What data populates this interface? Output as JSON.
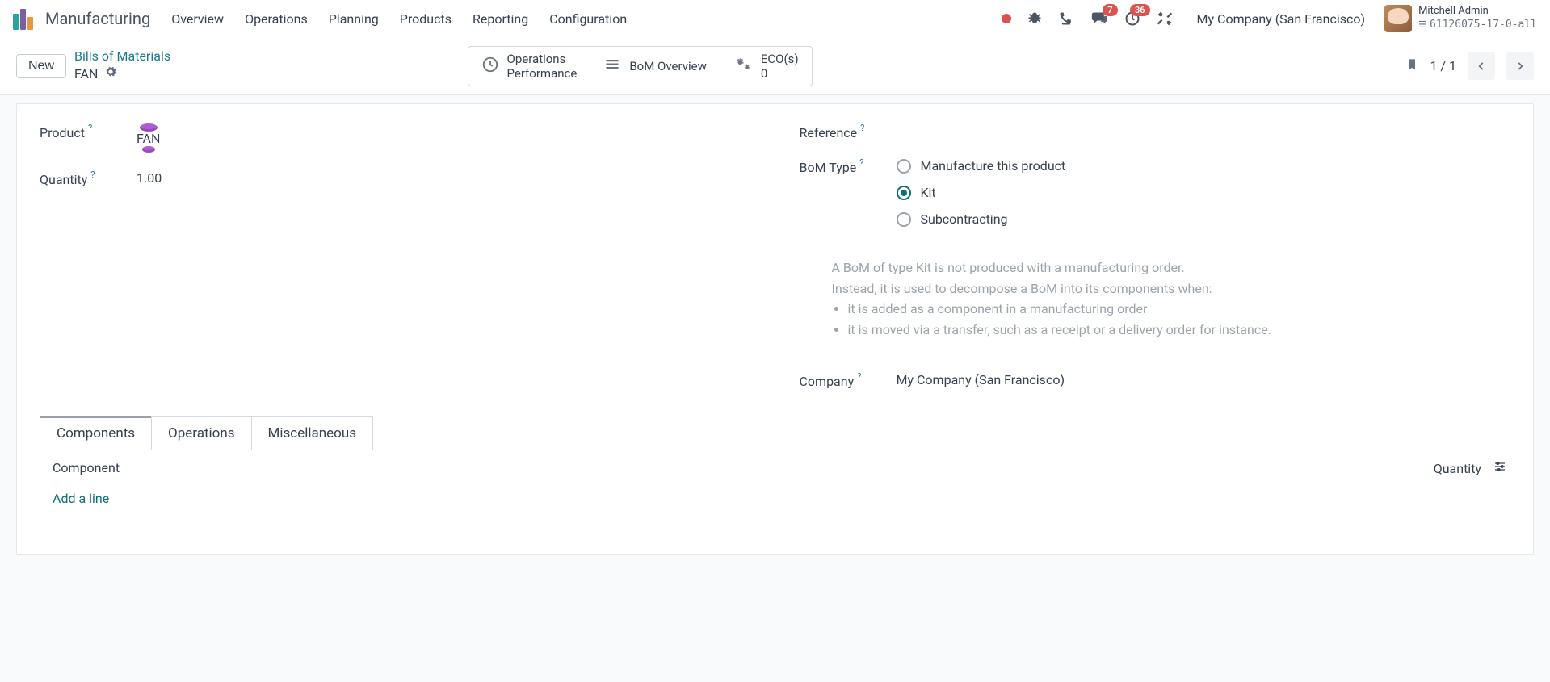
{
  "header": {
    "app_name": "Manufacturing",
    "menus": [
      "Overview",
      "Operations",
      "Planning",
      "Products",
      "Reporting",
      "Configuration"
    ],
    "badges": {
      "chat": "7",
      "activity": "36"
    },
    "company": "My Company (San Francisco)",
    "user_name": "Mitchell Admin",
    "db_name": "61126075-17-0-all"
  },
  "actionbar": {
    "new_label": "New",
    "breadcrumb_parent": "Bills of Materials",
    "breadcrumb_record": "FAN",
    "stats": {
      "ops_line1": "Operations",
      "ops_line2": "Performance",
      "bom_overview": "BoM Overview",
      "eco_line1": "ECO(s)",
      "eco_line2": "0"
    },
    "pager_text": "1 / 1"
  },
  "form": {
    "labels": {
      "product": "Product",
      "quantity": "Quantity",
      "reference": "Reference",
      "bom_type": "BoM Type",
      "company": "Company"
    },
    "values": {
      "product": "FAN",
      "quantity": "1.00",
      "reference": "",
      "company": "My Company (San Francisco)"
    },
    "bom_type_options": {
      "manufacture": "Manufacture this product",
      "kit": "Kit",
      "subcontracting": "Subcontracting"
    },
    "bom_type_selected": "kit",
    "kit_desc": {
      "p1": "A BoM of type Kit is not produced with a manufacturing order.",
      "p2": "Instead, it is used to decompose a BoM into its components when:",
      "li1": "it is added as a component in a manufacturing order",
      "li2": "it is moved via a transfer, such as a receipt or a delivery order for instance."
    }
  },
  "tabs": {
    "components": "Components",
    "operations": "Operations",
    "misc": "Miscellaneous",
    "col_component": "Component",
    "col_quantity": "Quantity",
    "add_line": "Add a line"
  }
}
